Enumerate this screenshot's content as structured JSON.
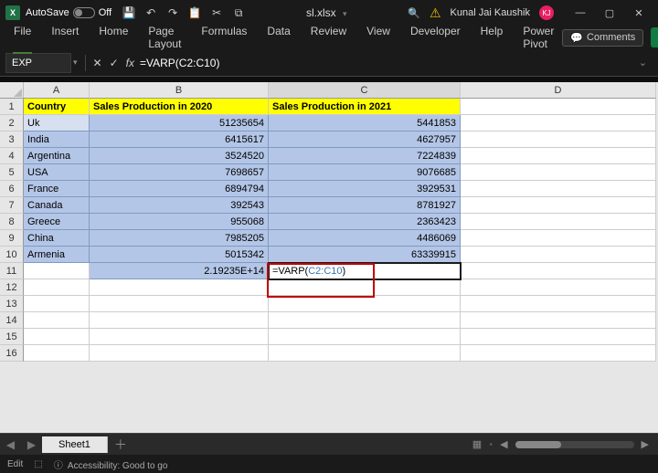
{
  "titlebar": {
    "autosave_label": "AutoSave",
    "autosave_state": "Off",
    "filename": "sl.xlsx",
    "search_icon": "search-icon",
    "user_name": "Kunal Jai Kaushik",
    "user_initials": "KJ"
  },
  "ribbon": {
    "tabs": [
      "File",
      "Insert",
      "Home",
      "Page Layout",
      "Formulas",
      "Data",
      "Review",
      "View",
      "Developer",
      "Help",
      "Power Pivot"
    ],
    "comments_label": "Comments"
  },
  "formula_bar": {
    "namebox": "EXP",
    "formula": "=VARP(C2:C10)"
  },
  "columns": [
    "A",
    "B",
    "C",
    "D"
  ],
  "headers": {
    "a": "Country",
    "b": "Sales Production in 2020",
    "c": "Sales Production in 2021"
  },
  "rows": [
    {
      "a": "Uk",
      "b": "51235654",
      "c": "5441853"
    },
    {
      "a": "India",
      "b": "6415617",
      "c": "4627957"
    },
    {
      "a": "Argentina",
      "b": "3524520",
      "c": "7224839"
    },
    {
      "a": "USA",
      "b": "7698657",
      "c": "9076685"
    },
    {
      "a": "France",
      "b": "6894794",
      "c": "3929531"
    },
    {
      "a": "Canada",
      "b": "392543",
      "c": "8781927"
    },
    {
      "a": "Greece",
      "b": "955068",
      "c": "2363423"
    },
    {
      "a": "China",
      "b": "7985205",
      "c": "4486069"
    },
    {
      "a": "Armenia",
      "b": "5015342",
      "c": "63339915"
    }
  ],
  "summary": {
    "b11": "2.19235E+14",
    "c11_prefix": "=VARP(",
    "c11_ref": "C2:C10",
    "c11_suffix": ")"
  },
  "sheet_tabs": {
    "active": "Sheet1"
  },
  "status": {
    "mode": "Edit",
    "accessibility": "Accessibility: Good to go"
  },
  "chart_data": {
    "type": "table",
    "headers": [
      "Country",
      "Sales Production in 2020",
      "Sales Production in 2021"
    ],
    "rows": [
      [
        "Uk",
        51235654,
        5441853
      ],
      [
        "India",
        6415617,
        4627957
      ],
      [
        "Argentina",
        3524520,
        7224839
      ],
      [
        "USA",
        7698657,
        9076685
      ],
      [
        "France",
        6894794,
        3929531
      ],
      [
        "Canada",
        392543,
        8781927
      ],
      [
        "Greece",
        955068,
        2363423
      ],
      [
        "China",
        7985205,
        4486069
      ],
      [
        "Armenia",
        5015342,
        63339915
      ]
    ],
    "computed": {
      "B11_VARP_display": "2.19235E+14",
      "C11_formula": "=VARP(C2:C10)"
    }
  }
}
